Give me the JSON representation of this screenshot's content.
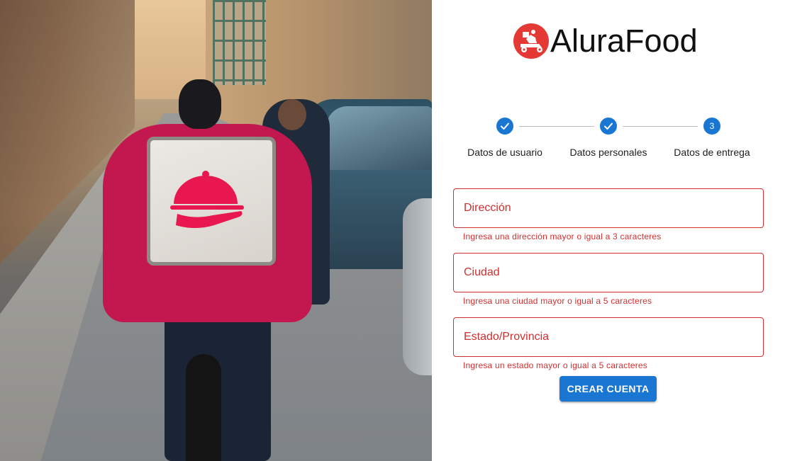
{
  "brand": {
    "name": "AluraFood",
    "logo_icon": "delivery-scooter-icon",
    "logo_color": "#e53935"
  },
  "hero_image": {
    "subject": "delivery-rider-photo"
  },
  "stepper": {
    "steps": [
      {
        "label": "Datos de usuario",
        "status": "completed",
        "icon": "check-icon"
      },
      {
        "label": "Datos personales",
        "status": "completed",
        "icon": "check-icon"
      },
      {
        "label": "Datos de entrega",
        "status": "active",
        "number": "3"
      }
    ]
  },
  "form": {
    "fields": [
      {
        "placeholder": "Dirección",
        "value": "",
        "error": "Ingresa una dirección mayor o igual a 3 caracteres"
      },
      {
        "placeholder": "Ciudad",
        "value": "",
        "error": "Ingresa una ciudad mayor o igual a 5 caracteres"
      },
      {
        "placeholder": "Estado/Provincia",
        "value": "",
        "error": "Ingresa un estado mayor o igual a 5 caracteres"
      }
    ],
    "submit_label": "CREAR CUENTA"
  },
  "colors": {
    "primary": "#1976d2",
    "error": "#d32f2f",
    "brand_red": "#e53935"
  }
}
